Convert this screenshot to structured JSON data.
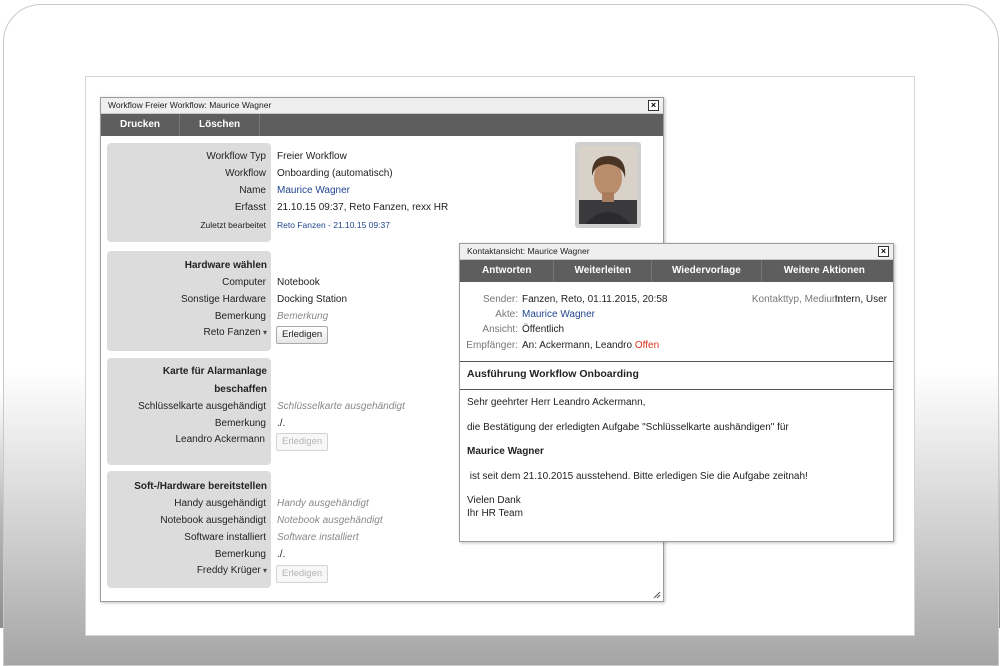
{
  "workflow_window": {
    "title": "Workflow Freier Workflow: Maurice Wagner",
    "toolbar": [
      "Drucken",
      "Löschen"
    ],
    "info": {
      "fields": [
        {
          "label": "Workflow Typ",
          "value": "Freier Workflow"
        },
        {
          "label": "Workflow",
          "value": "Onboarding (automatisch)"
        },
        {
          "label": "Name",
          "value": "Maurice Wagner"
        },
        {
          "label": "Erfasst",
          "value": "21.10.15 09:37, Reto Fanzen, rexx HR"
        },
        {
          "label": "Zuletzt bearbeitet",
          "value": "Reto Fanzen - 21.10.15 09:37"
        }
      ]
    },
    "hardware": {
      "title": "Hardware wählen",
      "fields": [
        {
          "label": "Computer",
          "value": "Notebook"
        },
        {
          "label": "Sonstige Hardware",
          "value": "Docking Station"
        },
        {
          "label": "Bemerkung",
          "value": "Bemerkung"
        }
      ],
      "responsible": "Reto Fanzen",
      "button": "Erledigen"
    },
    "karte": {
      "title_line1": "Karte für Alarmanlage",
      "title_line2": "beschaffen",
      "fields": [
        {
          "label": "Schlüsselkarte ausgehändigt",
          "value": "Schlüsselkarte ausgehändigt"
        },
        {
          "label": "Bemerkung",
          "value": "./."
        }
      ],
      "responsible": "Leandro Ackermann",
      "button": "Erledigen"
    },
    "soft": {
      "title": "Soft-/Hardware bereitstellen",
      "fields": [
        {
          "label": "Handy ausgehändigt",
          "value": "Handy ausgehändigt"
        },
        {
          "label": "Notebook ausgehändigt",
          "value": "Notebook ausgehändigt"
        },
        {
          "label": "Software installiert",
          "value": "Software installiert"
        },
        {
          "label": "Bemerkung",
          "value": "./."
        }
      ],
      "responsible": "Freddy Krüger",
      "button": "Erledigen"
    }
  },
  "contact_window": {
    "title": "Kontaktansicht: Maurice Wagner",
    "toolbar": [
      "Antworten",
      "Weiterleiten",
      "Wiedervorlage",
      "Weitere Aktionen"
    ],
    "meta": {
      "sender_label": "Sender:",
      "sender_value": "Fanzen, Reto, 01.11.2015, 20:58",
      "akte_label": "Akte:",
      "akte_value": "Maurice Wagner",
      "ansicht_label": "Ansicht:",
      "ansicht_value": "Öffentlich",
      "empf_label": "Empfänger:",
      "empf_value": "An: Ackermann, Leandro",
      "empf_status": "Offen",
      "kontakttyp_label": "Kontakttyp, Medium:",
      "kontakttyp_value": "Intern, User"
    },
    "subject": "Ausführung Workflow Onboarding",
    "body": {
      "greeting": "Sehr geehrter Herr Leandro Ackermann,",
      "line1": "die Bestätigung der erledigten Aufgabe \"Schlüsselkarte aushändigen\" für",
      "name": "Maurice Wagner",
      "line2": " ist seit dem 21.10.2015 ausstehend. Bitte erledigen Sie die Aufgabe zeitnah!",
      "closing1": "Vielen Dank",
      "closing2": "Ihr HR Team"
    }
  },
  "colors": {
    "toolbar": "#5e5e5e",
    "link": "#22478f",
    "status_open": "#e0301e",
    "panel": "#dcdcdc"
  }
}
